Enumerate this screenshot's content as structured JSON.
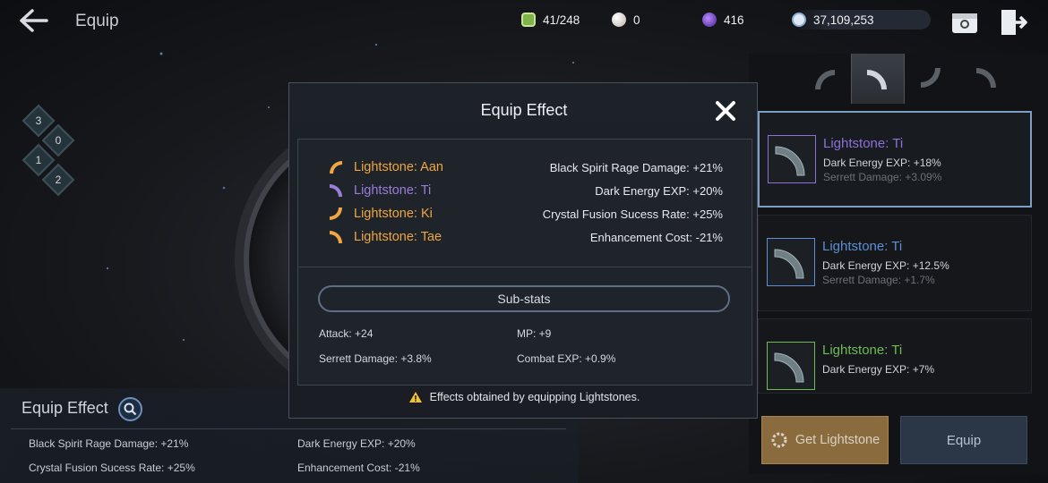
{
  "header": {
    "title": "Equip",
    "resources": [
      {
        "name": "energy",
        "icon": "energy-icon",
        "value": "41/248",
        "color": "#7fb24a"
      },
      {
        "name": "pearl",
        "icon": "pearl-icon",
        "value": "0",
        "color": "#d8d3cf"
      },
      {
        "name": "dark-energy",
        "icon": "dark-orb-icon",
        "value": "416",
        "color": "#7a3fd1"
      },
      {
        "name": "silver",
        "icon": "silver-coin-icon",
        "value": "37,109,253",
        "color": "#a9c6e8"
      }
    ]
  },
  "indicators": [
    "3",
    "0",
    "1",
    "2"
  ],
  "right_panel": {
    "tabs": [
      "lightstone-slot-1",
      "lightstone-slot-2",
      "lightstone-slot-3",
      "lightstone-slot-4"
    ],
    "active_tab": 1,
    "cards": [
      {
        "name": "Lightstone: Ti",
        "stat1": "Dark Energy EXP: +18%",
        "stat2": "Serrett Damage: +3.09%",
        "color": "#8d71d9",
        "selected": true
      },
      {
        "name": "Lightstone: Ti",
        "stat1": "Dark Energy EXP: +12.5%",
        "stat2": "Serrett Damage: +1.7%",
        "color": "#5d8fd2",
        "selected": false
      },
      {
        "name": "Lightstone: Ti",
        "stat1": "Dark Energy EXP: +7%",
        "stat2": "",
        "color": "#6dbb54",
        "selected": false
      }
    ],
    "get_button": "Get Lightstone",
    "equip_button": "Equip"
  },
  "equip_effect_panel": {
    "title": "Equip Effect",
    "rows": [
      "Black Spirit Rage Damage: +21%",
      "Dark Energy EXP: +20%",
      "Crystal Fusion Sucess Rate: +25%",
      "Enhancement Cost: -21%"
    ]
  },
  "modal": {
    "title": "Equip Effect",
    "lightstones": [
      {
        "name": "Lightstone: Aan",
        "color": "#f0a642",
        "effect": "Black Spirit Rage Damage: +21%"
      },
      {
        "name": "Lightstone: Ti",
        "color": "#9b7ddb",
        "effect": "Dark Energy EXP: +20%"
      },
      {
        "name": "Lightstone: Ki",
        "color": "#f0a642",
        "effect": "Crystal Fusion Sucess Rate: +25%"
      },
      {
        "name": "Lightstone: Tae",
        "color": "#f0a642",
        "effect": "Enhancement Cost: -21%"
      }
    ],
    "substats_label": "Sub-stats",
    "substats": [
      "Attack: +24",
      "MP: +9",
      "Serrett Damage: +3.8%",
      "Combat EXP: +0.9%"
    ],
    "note": "Effects obtained by equipping Lightstones."
  }
}
